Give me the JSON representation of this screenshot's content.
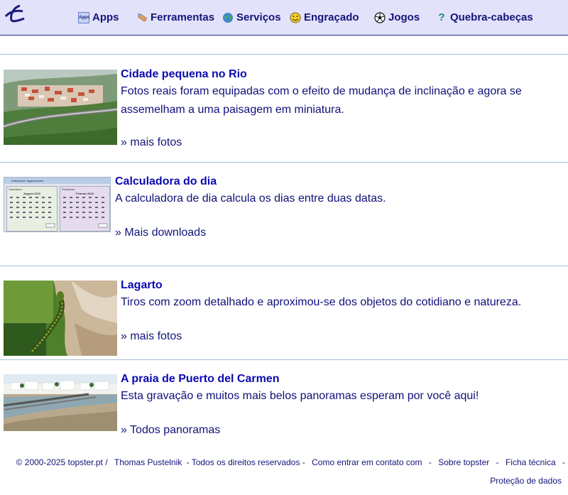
{
  "nav": {
    "apps": "Apps",
    "tools": "Ferramentas",
    "services": "Serviços",
    "funny": "Engraçado",
    "games": "Jogos",
    "puzzles": "Quebra-cabeças",
    "apps_icon_text": "Apps"
  },
  "articles": [
    {
      "title": "Cidade pequena no Rio",
      "description": "Fotos reais foram equipadas com o efeito de mudança de inclinação e agora se assemelham a uma paisagem em miniatura.",
      "link": "» mais fotos"
    },
    {
      "title": "Calculadora do dia",
      "description": "A calculadora de dia calcula os dias entre duas datas.",
      "link": "» Mais downloads",
      "calendar": {
        "window_title": "Zeitrechner Tagesrechner",
        "left_tab": "Startdatum",
        "left_month": "August 2015",
        "right_tab": "Enddatum",
        "right_month": "Februar 2015"
      }
    },
    {
      "title": "Lagarto",
      "description": "Tiros com zoom detalhado e aproximou-se dos objetos do cotidiano e natureza.",
      "link": "» mais fotos"
    },
    {
      "title": "A praia de Puerto del Carmen",
      "description": "Esta gravação e muitos mais belos panoramas esperam por você aqui!",
      "link": "» Todos panoramas"
    }
  ],
  "footer": {
    "copyright": "© 2000-2025 topster.pt /",
    "author": "Thomas Pustelnik",
    "rights": "- Todos os direitos reservados -",
    "contact": "Como entrar em contato com",
    "about": "Sobre topster",
    "tech": "Ficha técnica",
    "privacy": "Proteção de dados",
    "sep": "-"
  },
  "colors": {
    "topbar": "#e2e2fb",
    "title": "#0a0ab0",
    "text": "#10107a",
    "rule": "#a9bfd6"
  }
}
